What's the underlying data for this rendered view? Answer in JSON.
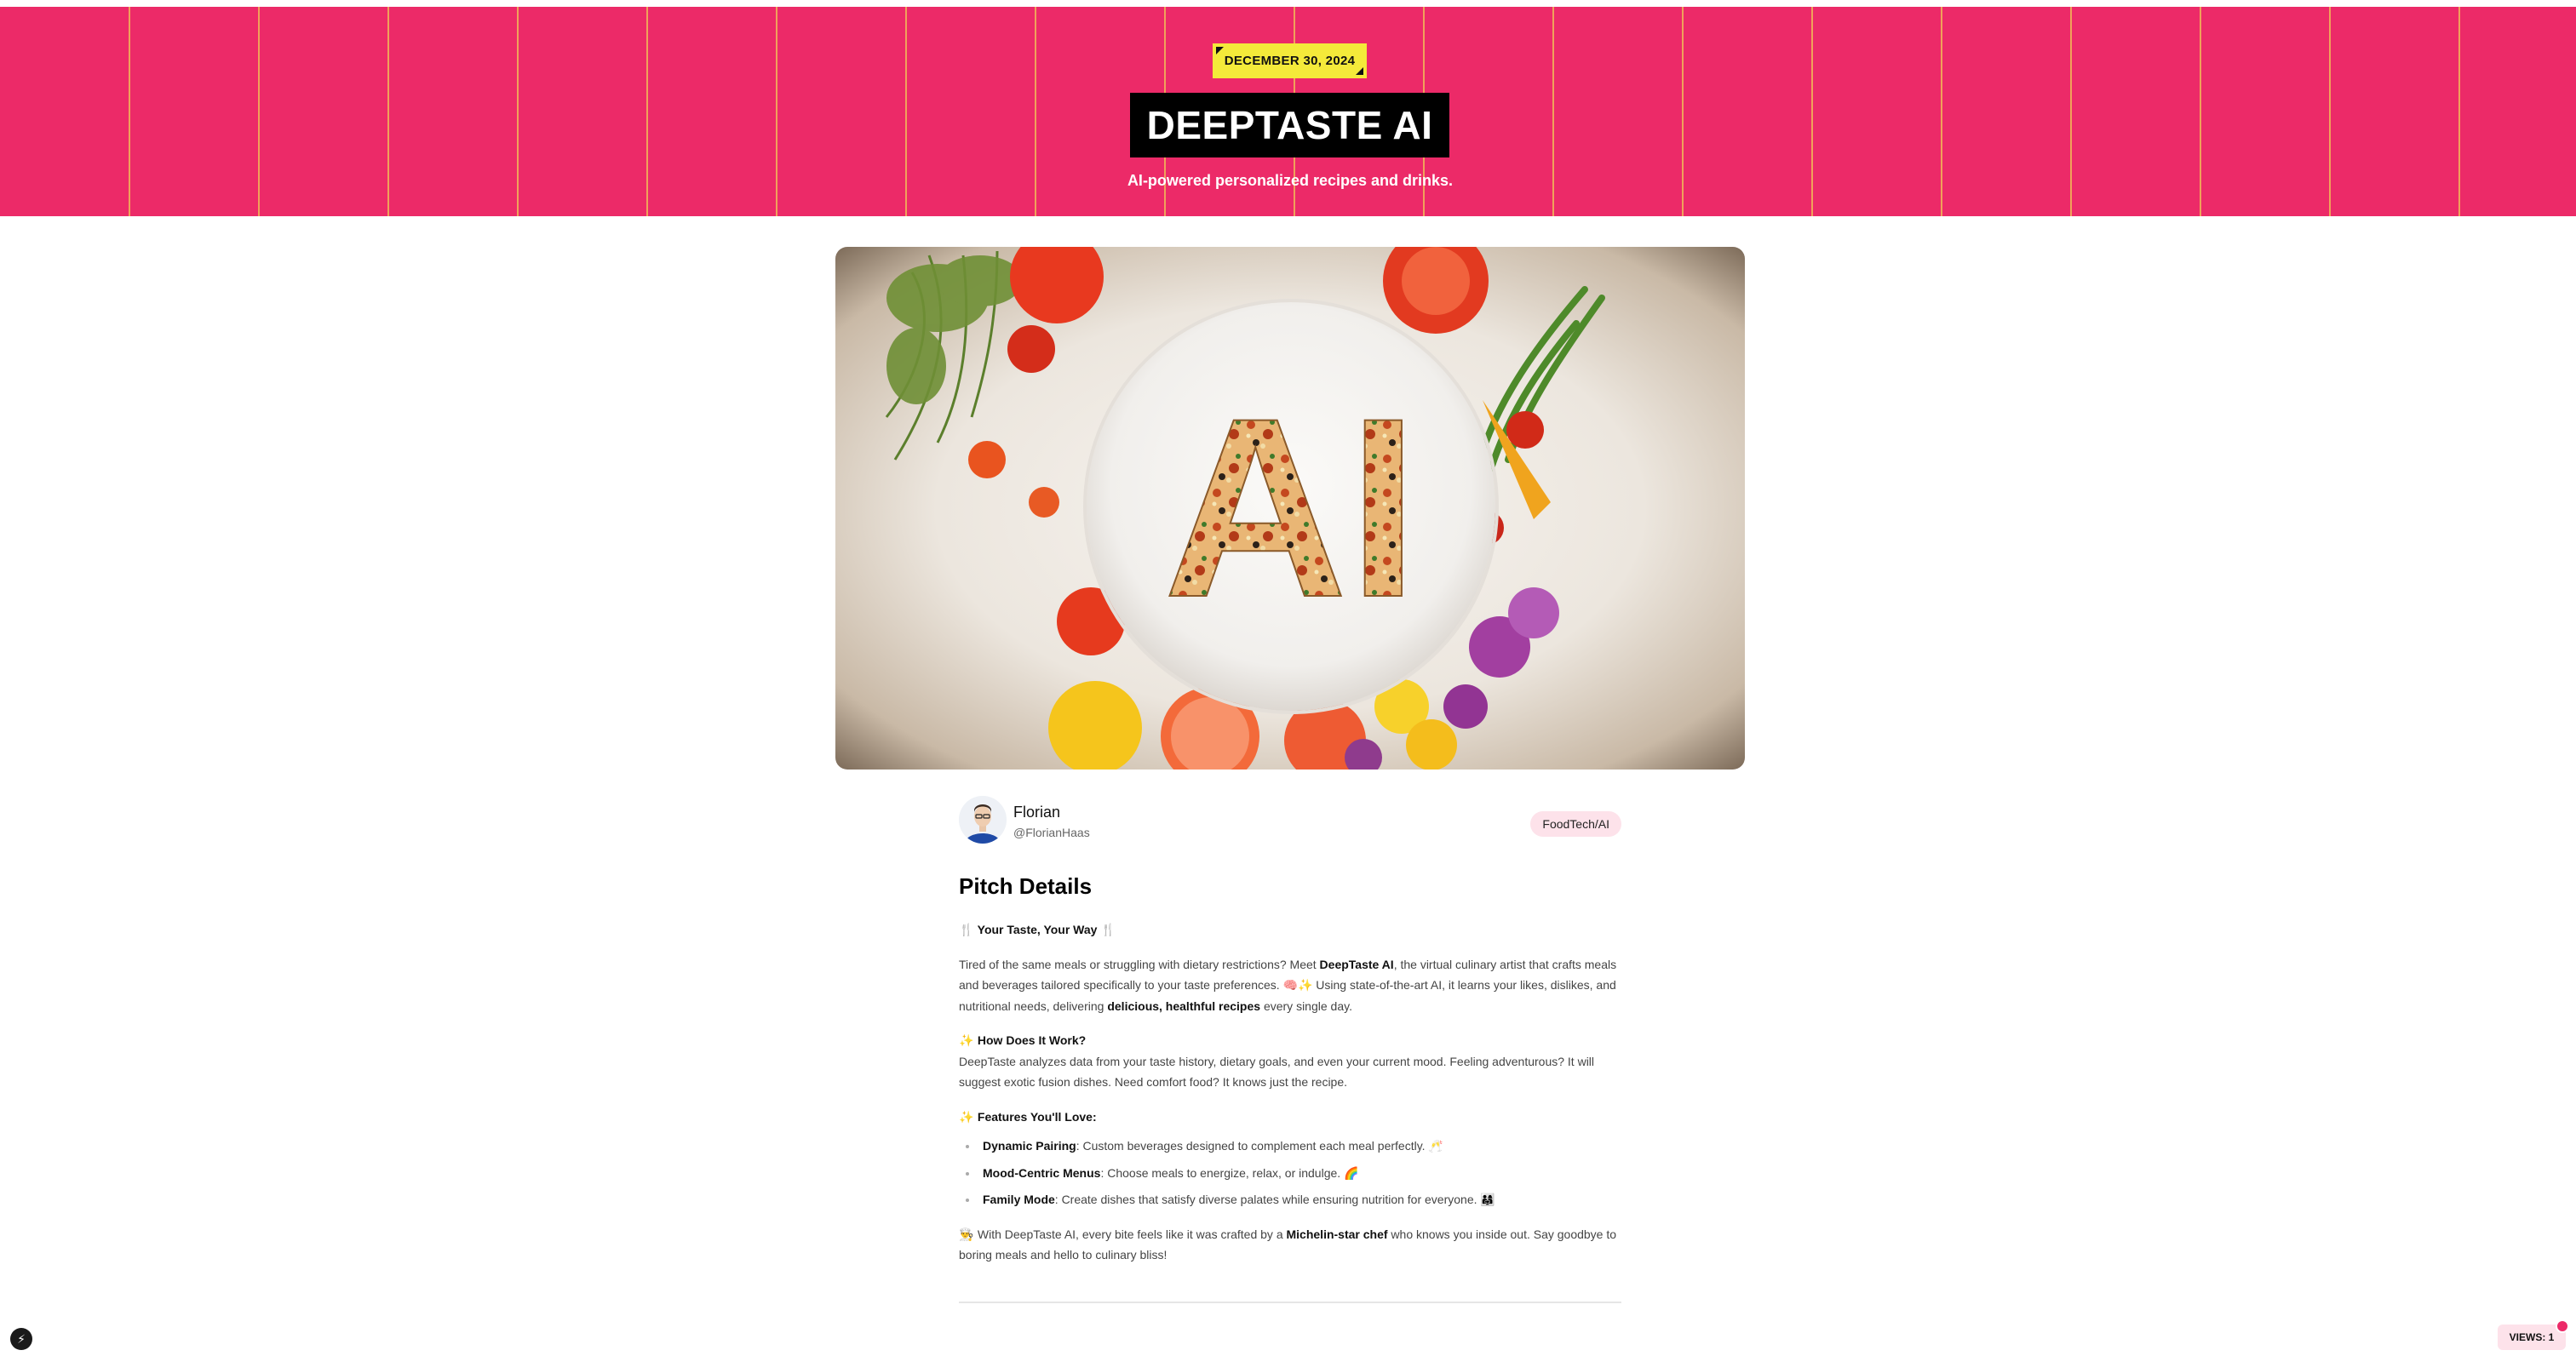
{
  "header": {
    "date": "DECEMBER 30, 2024",
    "title": "DEEPTASTE AI",
    "subtitle": "AI-powered personalized recipes and drinks.",
    "bg_color": "#ec2a68",
    "stripe_color": "#f0a15a",
    "badge_color": "#f4ea3a"
  },
  "hero": {
    "image_text": "AI",
    "image_subject": "vegetables-around-plate-with-pizza-letters"
  },
  "author": {
    "name": "Florian",
    "handle": "@FlorianHaas",
    "tag": "FoodTech/AI"
  },
  "article": {
    "heading": "Pitch Details",
    "tagline": {
      "icon": "fork-knife-icon",
      "text": "Your Taste, Your Way"
    },
    "intro": {
      "t1": "Tired of the same meals or struggling with dietary restrictions? Meet ",
      "b1": "DeepTaste AI",
      "t2": ", the virtual culinary artist that crafts meals and beverages tailored specifically to your taste preferences. 🧠✨ Using state-of-the-art AI, it learns your likes, dislikes, and nutritional needs, delivering ",
      "b2": "delicious, healthful recipes",
      "t3": " every single day."
    },
    "how": {
      "heading": "How Does It Work?",
      "body": "DeepTaste analyzes data from your taste history, dietary goals, and even your current mood. Feeling adventurous? It will suggest exotic fusion dishes. Need comfort food? It knows just the recipe."
    },
    "features_heading": "Features You'll Love:",
    "features": [
      {
        "title": "Dynamic Pairing",
        "text": ": Custom beverages designed to complement each meal perfectly. 🥂"
      },
      {
        "title": "Mood-Centric Menus",
        "text": ": Choose meals to energize, relax, or indulge. 🌈"
      },
      {
        "title": "Family Mode",
        "text": ": Create dishes that satisfy diverse palates while ensuring nutrition for everyone. 👨‍👩‍👧"
      }
    ],
    "closing": {
      "t1": "With DeepTaste AI, every bite feels like it was crafted by a ",
      "b1": "Michelin-star chef",
      "t2": " who knows you inside out. Say goodbye to boring meals and hello to culinary bliss!"
    }
  },
  "footer": {
    "views_label": "VIEWS: 1",
    "bolt_icon": "lightning-icon"
  }
}
